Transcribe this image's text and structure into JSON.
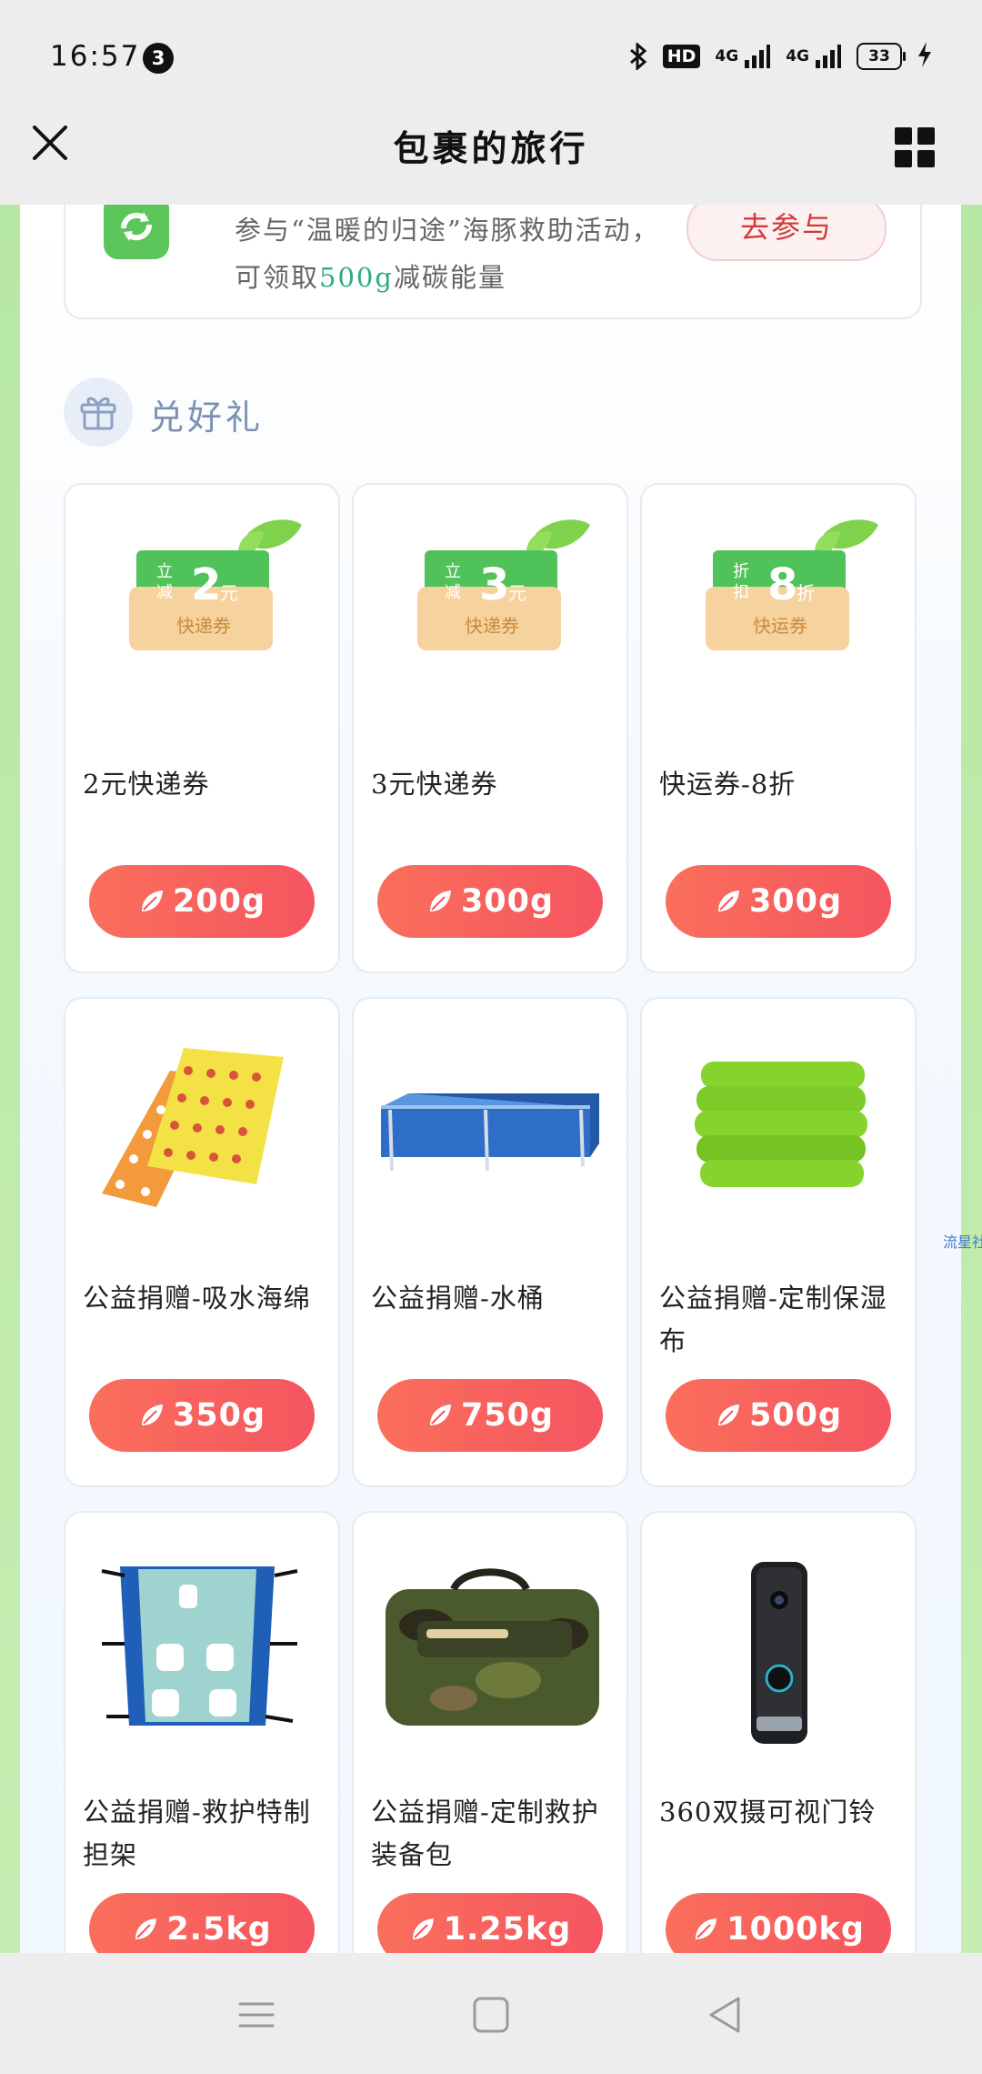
{
  "status": {
    "time": "16:57",
    "notification_count": "3",
    "hd": "HD",
    "net1": "4G",
    "net2": "4G",
    "battery": "33"
  },
  "titlebar": {
    "title": "包裹的旅行"
  },
  "activity": {
    "text_before": "参与“温暖的归途”海豚救助活动，可领取",
    "highlight": "500g",
    "text_after": "减碳能量",
    "button": "去参与"
  },
  "section": {
    "title": "兑好礼"
  },
  "items": [
    {
      "name": "2元快递券",
      "price": "200g",
      "coupon": {
        "l1": "立",
        "l2": "减",
        "num": "2",
        "unit": "元",
        "label": "快递券"
      }
    },
    {
      "name": "3元快递券",
      "price": "300g",
      "coupon": {
        "l1": "立",
        "l2": "减",
        "num": "3",
        "unit": "元",
        "label": "快递券"
      }
    },
    {
      "name": "快运券-8折",
      "price": "300g",
      "coupon": {
        "l1": "折",
        "l2": "扣",
        "num": "8",
        "unit": "折",
        "label": "快运券"
      }
    },
    {
      "name": "公益捐赠-吸水海绵",
      "price": "350g",
      "image": "sponge-mats-image"
    },
    {
      "name": "公益捐赠-水桶",
      "price": "750g",
      "image": "water-tank-image"
    },
    {
      "name": "公益捐赠-定制保湿布",
      "price": "500g",
      "image": "green-towels-image"
    },
    {
      "name": "公益捐赠-救护特制担架",
      "price": "2.5kg",
      "image": "stretcher-image"
    },
    {
      "name": "公益捐赠-定制救护装备包",
      "price": "1.25kg",
      "image": "camo-bag-image"
    },
    {
      "name": "360双摄可视门铃",
      "price": "1000kg",
      "image": "doorbell-image"
    }
  ],
  "side_tag": "流星社区",
  "colors": {
    "accent_green": "#2fab86",
    "price_red": "#f5555f",
    "page_green": "#b7e7a4"
  }
}
